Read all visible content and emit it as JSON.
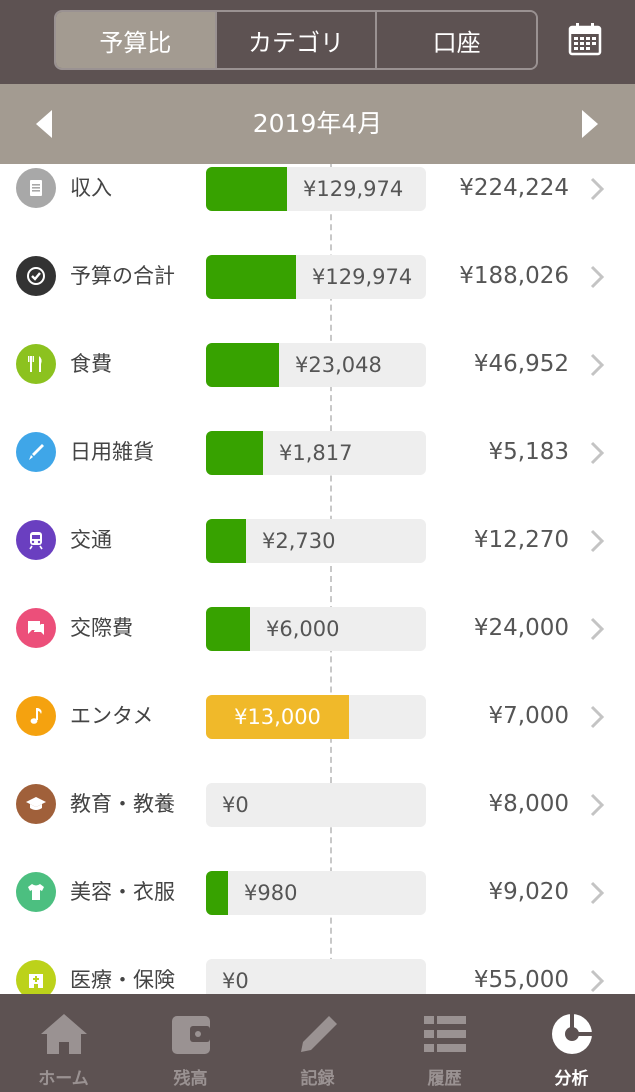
{
  "header": {
    "segments": [
      {
        "label": "予算比",
        "active": true
      },
      {
        "label": "カテゴリ",
        "active": false
      },
      {
        "label": "口座",
        "active": false
      }
    ],
    "calendar_icon": "calendar-icon"
  },
  "month": {
    "title": "2019年4月",
    "prev_icon": "arrow-left-icon",
    "next_icon": "arrow-right-icon"
  },
  "rows": [
    {
      "name": "収入",
      "icon": "receipt-icon",
      "color": "#a8a8a8",
      "value": "¥129,974",
      "remaining": "¥224,224",
      "progress": 0.37,
      "over": false
    },
    {
      "name": "予算の合計",
      "icon": "check-icon",
      "color": "#333333",
      "value": "¥129,974",
      "remaining": "¥188,026",
      "progress": 0.41,
      "over": false
    },
    {
      "name": "食費",
      "icon": "fork-knife-icon",
      "color": "#8cc21f",
      "value": "¥23,048",
      "remaining": "¥46,952",
      "progress": 0.33,
      "over": false
    },
    {
      "name": "日用雑貨",
      "icon": "brush-icon",
      "color": "#3fa6e8",
      "value": "¥1,817",
      "remaining": "¥5,183",
      "progress": 0.26,
      "over": false
    },
    {
      "name": "交通",
      "icon": "train-icon",
      "color": "#6a3fc0",
      "value": "¥2,730",
      "remaining": "¥12,270",
      "progress": 0.18,
      "over": false
    },
    {
      "name": "交際費",
      "icon": "chat-icon",
      "color": "#ec4f7a",
      "value": "¥6,000",
      "remaining": "¥24,000",
      "progress": 0.2,
      "over": false
    },
    {
      "name": "エンタメ",
      "icon": "music-note-icon",
      "color": "#f5a20f",
      "value": "¥13,000",
      "remaining": "¥7,000",
      "progress": 0.65,
      "over": true
    },
    {
      "name": "教育・教養",
      "icon": "graduation-cap-icon",
      "color": "#a0603a",
      "value": "¥0",
      "remaining": "¥8,000",
      "progress": 0,
      "over": false
    },
    {
      "name": "美容・衣服",
      "icon": "shirt-icon",
      "color": "#4cbf80",
      "value": "¥980",
      "remaining": "¥9,020",
      "progress": 0.1,
      "over": false
    },
    {
      "name": "医療・保険",
      "icon": "hospital-icon",
      "color": "#bcd21a",
      "value": "¥0",
      "remaining": "¥55,000",
      "progress": 0,
      "over": false
    }
  ],
  "tabs": [
    {
      "label": "ホーム",
      "icon": "home-icon",
      "active": false
    },
    {
      "label": "残高",
      "icon": "wallet-icon",
      "active": false
    },
    {
      "label": "記録",
      "icon": "pencil-icon",
      "active": false
    },
    {
      "label": "履歴",
      "icon": "list-icon",
      "active": false
    },
    {
      "label": "分析",
      "icon": "pie-chart-icon",
      "active": true
    }
  ],
  "colors": {
    "header_bg": "#5d5252",
    "month_bg": "#a39b91",
    "bar_normal": "#37a200",
    "bar_over": "#f0b92a",
    "bar_track": "#eeeeee"
  }
}
